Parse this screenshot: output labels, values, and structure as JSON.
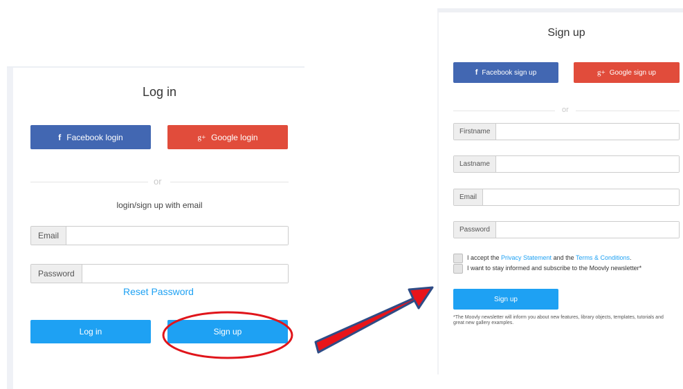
{
  "login": {
    "title": "Log in",
    "facebook_label": "Facebook login",
    "google_label": "Google login",
    "or_label": "or",
    "email_prompt": "login/sign up with email",
    "email_label": "Email",
    "password_label": "Password",
    "reset_password": "Reset Password",
    "login_button": "Log in",
    "signup_button": "Sign up"
  },
  "signup": {
    "title": "Sign up",
    "facebook_label": "Facebook sign up",
    "google_label": "Google sign up",
    "or_label": "or",
    "firstname_label": "Firstname",
    "lastname_label": "Lastname",
    "email_label": "Email",
    "password_label": "Password",
    "accept_prefix": "I accept the ",
    "privacy_link": "Privacy Statement",
    "accept_middle": " and the ",
    "terms_link": "Terms & Conditions",
    "accept_suffix": ".",
    "newsletter_label": "I want to stay informed and subscribe to the Moovly newsletter*",
    "signup_button": "Sign up",
    "footnote": "*The Moovly newsletter will inform you about new features, library objects, templates, tutorials and great new gallery examples."
  },
  "icons": {
    "facebook": "facebook-icon",
    "google": "google-plus-icon"
  },
  "colors": {
    "facebook": "#4267b2",
    "google": "#e14c3b",
    "primary": "#1ea1f3",
    "highlight_circle": "#e0151b",
    "arrow_fill": "#e8141a",
    "arrow_outline": "#2f4c86"
  }
}
